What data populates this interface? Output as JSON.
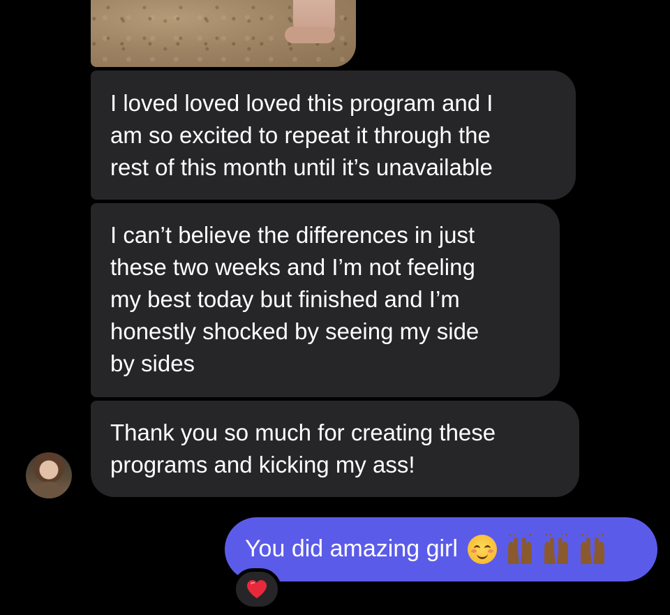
{
  "conversation": {
    "received_messages": [
      {
        "lines": [
          "I loved loved loved this program and I",
          "am so excited to repeat it through the",
          "rest of this month until it’s unavailable"
        ]
      },
      {
        "lines": [
          "I can’t believe the differences in just",
          "these two weeks and I’m not feeling",
          "my best today but finished and I’m",
          "honestly shocked by seeing my side",
          "by sides"
        ]
      },
      {
        "lines": [
          "Thank you so much for creating these",
          "programs and kicking my ass!"
        ]
      }
    ],
    "sent_message": {
      "text": "You did amazing girl",
      "emojis": [
        "smiling-face-icon",
        "raising-hands-icon",
        "raising-hands-icon",
        "raising-hands-icon"
      ],
      "reaction": "red-heart-icon"
    }
  },
  "colors": {
    "background": "#000000",
    "received_bubble": "#262628",
    "sent_bubble": "#5b5bea",
    "text": "#ffffff",
    "heart": "#e8293b"
  }
}
